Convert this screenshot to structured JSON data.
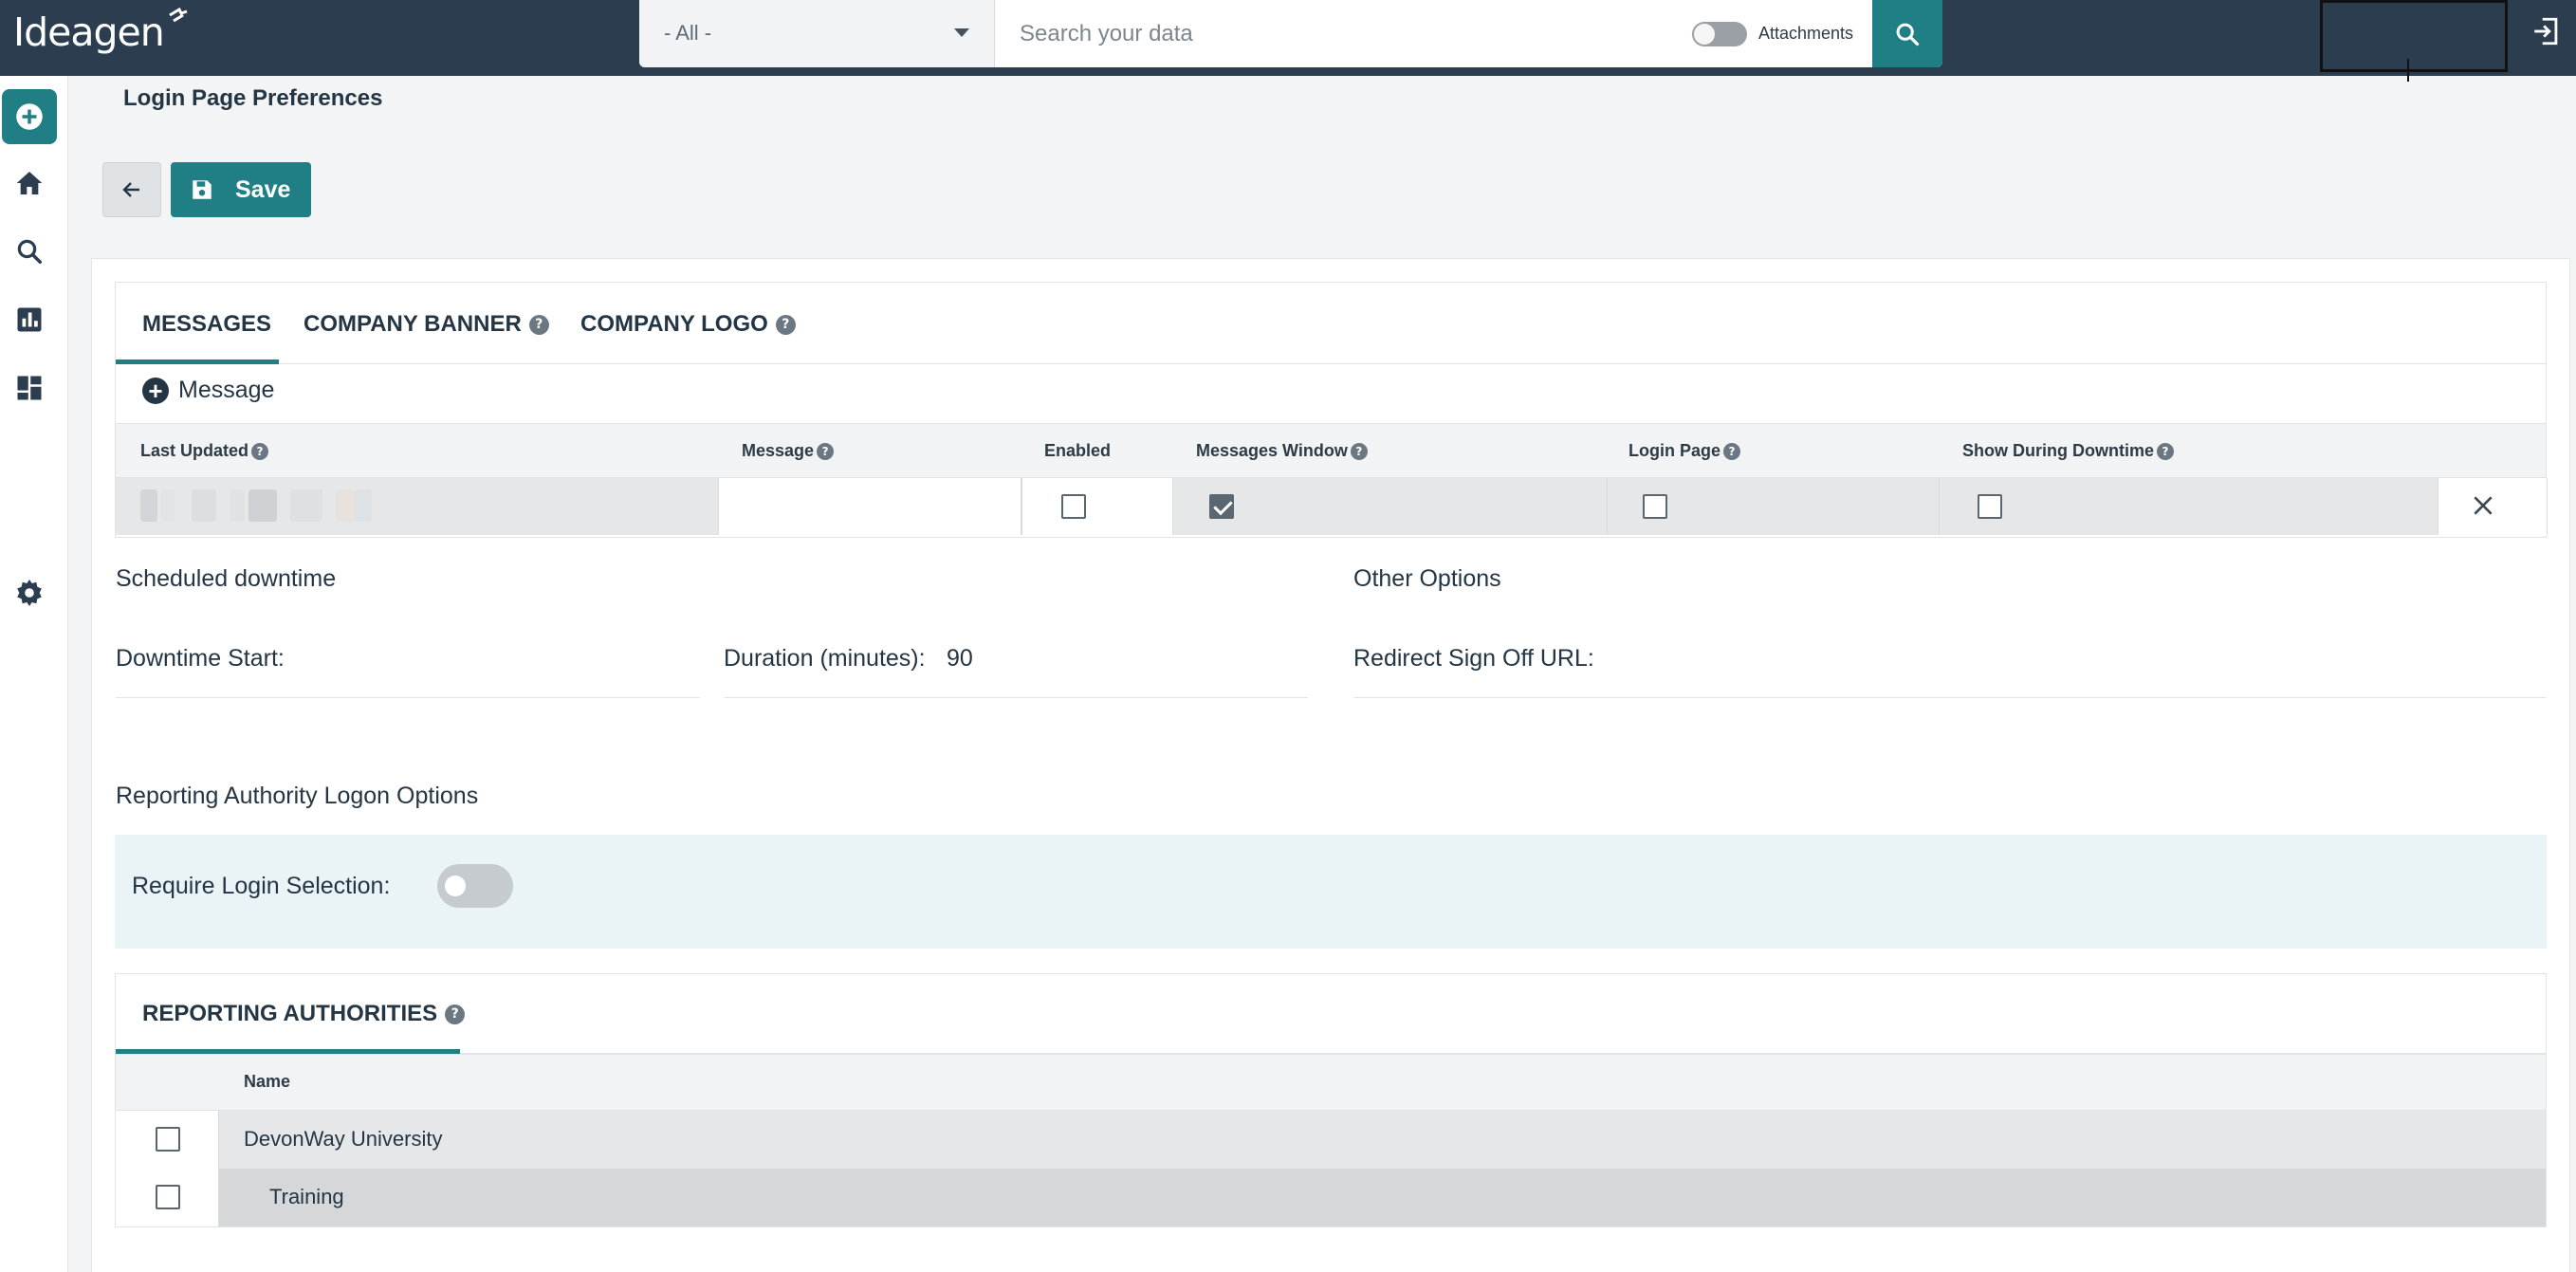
{
  "app": {
    "brand": "Ideagen"
  },
  "search": {
    "scope_value": "- All -",
    "placeholder": "Search your data",
    "attachments_label": "Attachments",
    "attachments_on": false
  },
  "page": {
    "title": "Login Page Preferences",
    "save_label": "Save"
  },
  "messages_tabs": [
    {
      "label": "MESSAGES",
      "active": true,
      "help": false
    },
    {
      "label": "COMPANY BANNER",
      "active": false,
      "help": true
    },
    {
      "label": "COMPANY LOGO",
      "active": false,
      "help": true
    }
  ],
  "messages": {
    "add_label": "Message",
    "columns": {
      "last_updated": "Last Updated",
      "message": "Message",
      "enabled": "Enabled",
      "messages_window": "Messages Window",
      "login_page": "Login Page",
      "show_during_downtime": "Show During Downtime"
    },
    "rows": [
      {
        "last_updated": "",
        "message": "",
        "enabled": false,
        "messages_window": true,
        "login_page": false,
        "show_during_downtime": false
      }
    ]
  },
  "downtime": {
    "heading": "Scheduled downtime",
    "start_label": "Downtime Start:",
    "start_value": "",
    "duration_label": "Duration (minutes):",
    "duration_value": "90"
  },
  "other": {
    "heading": "Other Options",
    "redirect_label": "Redirect Sign Off URL:",
    "redirect_value": ""
  },
  "reporting": {
    "heading": "Reporting Authority Logon Options",
    "require_label": "Require Login Selection:",
    "require_on": false,
    "tab_label": "REPORTING AUTHORITIES",
    "column_name": "Name",
    "rows": [
      {
        "name": "DevonWay University",
        "checked": false
      },
      {
        "name": "Training",
        "checked": false
      }
    ]
  },
  "colors": {
    "topbar": "#2b3d4f",
    "accent": "#1f7f84",
    "text": "#243544"
  }
}
